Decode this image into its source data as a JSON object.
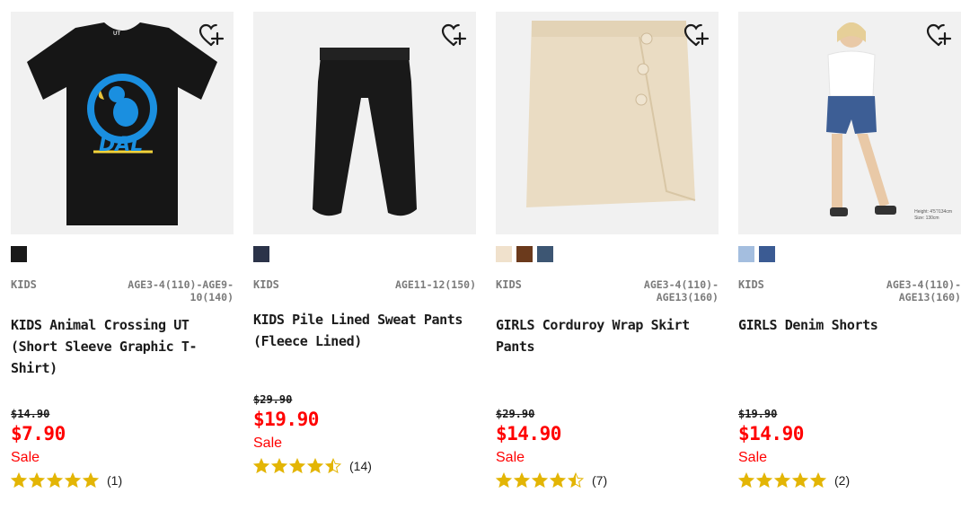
{
  "colors": {
    "sale_red": "#ff0000",
    "star_gold": "#e3b505",
    "meta_gray": "#7b7b7b"
  },
  "products": [
    {
      "swatches": [
        "#1a1a1a"
      ],
      "gender": "KIDS",
      "sizes": "AGE3-4(110)-AGE9-10(140)",
      "name": "KIDS Animal Crossing UT (Short Sleeve Graphic T-Shirt)",
      "old_price": "$14.90",
      "price": "$7.90",
      "sale_label": "Sale",
      "rating": 5,
      "review_count": "(1)",
      "image_text": "DAL",
      "brand_text": "UT"
    },
    {
      "swatches": [
        "#2b3349"
      ],
      "gender": "KIDS",
      "sizes": "AGE11-12(150)",
      "name": "KIDS Pile Lined Sweat Pants (Fleece Lined)",
      "old_price": "$29.90",
      "price": "$19.90",
      "sale_label": "Sale",
      "rating": 4.5,
      "review_count": "(14)"
    },
    {
      "swatches": [
        "#f0e1cc",
        "#6b3a1c",
        "#3d5673"
      ],
      "gender": "KIDS",
      "sizes": "AGE3-4(110)-AGE13(160)",
      "name": "GIRLS Corduroy Wrap Skirt Pants",
      "old_price": "$29.90",
      "price": "$14.90",
      "sale_label": "Sale",
      "rating": 4.5,
      "review_count": "(7)"
    },
    {
      "swatches": [
        "#a4bedf",
        "#3b5b93"
      ],
      "gender": "KIDS",
      "sizes": "AGE3-4(110)-AGE13(160)",
      "name": "GIRLS Denim Shorts",
      "old_price": "$19.90",
      "price": "$14.90",
      "sale_label": "Sale",
      "rating": 5,
      "review_count": "(2)",
      "model_info": [
        "Height: 4'5\"/134cm",
        "Size: 130cm"
      ]
    }
  ]
}
